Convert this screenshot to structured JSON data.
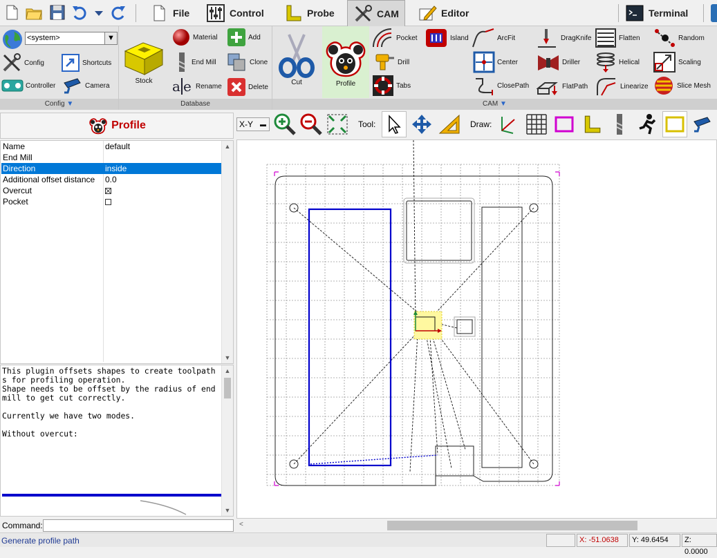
{
  "tabs": [
    {
      "label": "File",
      "icon": "file-icon"
    },
    {
      "label": "Control",
      "icon": "control-icon"
    },
    {
      "label": "Probe",
      "icon": "probe-icon"
    },
    {
      "label": "CAM",
      "icon": "cam-icon",
      "active": true
    },
    {
      "label": "Editor",
      "icon": "editor-icon"
    },
    {
      "label": "Terminal",
      "icon": "terminal-icon"
    }
  ],
  "ribbon": {
    "config": {
      "group_label": "Config",
      "dropdown_value": "<system>",
      "items": [
        "Config",
        "Shortcuts",
        "Controller",
        "Camera"
      ]
    },
    "database": {
      "group_label": "Database",
      "stock": "Stock",
      "items": [
        "Material",
        "Add",
        "End Mill",
        "Clone",
        "Rename",
        "Delete"
      ]
    },
    "cam": {
      "group_label": "CAM",
      "cut": "Cut",
      "profile": "Profile",
      "items": [
        "Pocket",
        "Island",
        "ArcFit",
        "DragKnife",
        "Flatten",
        "Random",
        "Drill",
        "Center",
        "Driller",
        "Helical",
        "Scaling",
        "Tabs",
        "ClosePath",
        "FlatPath",
        "Linearize",
        "Slice Mesh"
      ]
    }
  },
  "left_panel": {
    "title": "Profile",
    "properties": [
      {
        "name": "Name",
        "value": "default"
      },
      {
        "name": "End Mill",
        "value": ""
      },
      {
        "name": "Direction",
        "value": "inside",
        "selected": true
      },
      {
        "name": "Additional offset distance",
        "value": "0.0"
      },
      {
        "name": "Overcut",
        "checkbox": true,
        "checked": true
      },
      {
        "name": "Pocket",
        "checkbox": true,
        "checked": false
      }
    ],
    "help_text": "This plugin offsets shapes to create toolpath\ns for profiling operation.\nShape needs to be offset by the radius of end\nmill to get cut correctly.\n\nCurrently we have two modes.\n\nWithout overcut:"
  },
  "canvas_toolbar": {
    "view": "X-Y",
    "tool_label": "Tool:",
    "draw_label": "Draw:"
  },
  "command": {
    "label": "Command:",
    "value": ""
  },
  "status": {
    "message": "Generate profile path",
    "x": "X: -51.0638",
    "y": "Y: 49.6454",
    "z": "Z: 0.0000"
  },
  "colors": {
    "accent_blue": "#0078d7",
    "profile_red": "#c00000",
    "path_blue": "#0000cc"
  }
}
